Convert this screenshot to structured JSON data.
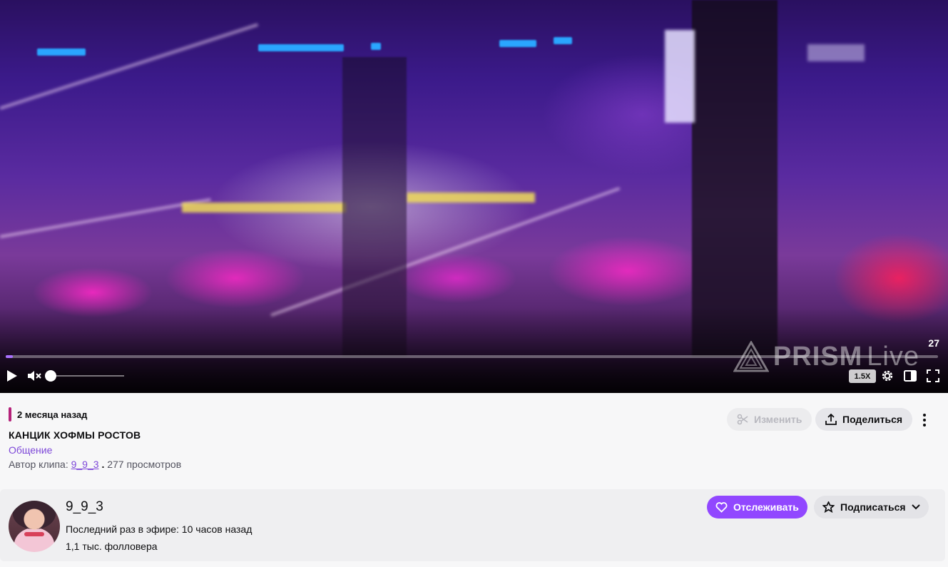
{
  "player": {
    "watermark_brand": "PRISM",
    "watermark_suffix": "Live",
    "time_display": "27",
    "speed_label": "1.5X",
    "progress": 0.008,
    "volume": 0.0,
    "muted": true,
    "icons": [
      "play-icon",
      "muted-speaker-icon",
      "settings-gear-icon",
      "theatre-mode-icon",
      "fullscreen-icon"
    ]
  },
  "clip": {
    "date": "2 месяца назад",
    "title": "КАНЦИК ХОФМЫ РОСТОВ",
    "category": "Общение",
    "author_prefix": "Автор клипа:",
    "author": "9_9_3",
    "separator": ".",
    "views": "277 просмотров",
    "edit_label": "Изменить",
    "share_label": "Поделиться",
    "accent_color": "#b5227a"
  },
  "channel": {
    "name": "9_9_3",
    "last_live": "Последний раз в эфире: 10 часов назад",
    "followers": "1,1 тыс. фолловера",
    "follow_label": "Отслеживать",
    "subscribe_label": "Подписаться",
    "brand_color": "#9147ff"
  }
}
